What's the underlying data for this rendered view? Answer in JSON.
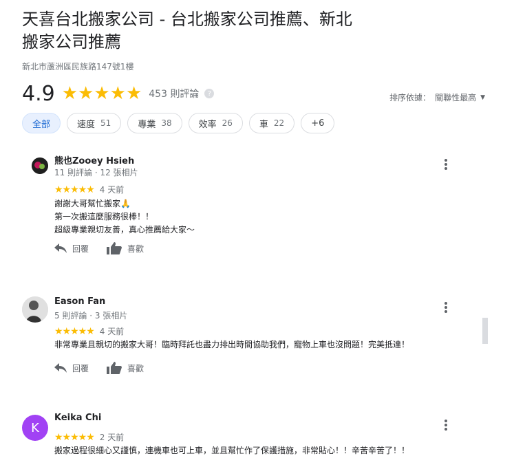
{
  "business": {
    "title": "天喜台北搬家公司 - 台北搬家公司推薦、新北搬家公司推薦",
    "address": "新北市蘆洲區民族路147號1樓",
    "rating": "4.9",
    "stars": "★★★★★",
    "review_count": "453 則評論",
    "help_icon": "?"
  },
  "sort": {
    "label": "排序依據：",
    "value": "關聯性最高",
    "caret": "▼"
  },
  "chips": [
    {
      "label": "全部",
      "num": ""
    },
    {
      "label": "速度",
      "num": "51"
    },
    {
      "label": "專業",
      "num": "38"
    },
    {
      "label": "效率",
      "num": "26"
    },
    {
      "label": "車",
      "num": "22"
    },
    {
      "label": "+6",
      "num": ""
    }
  ],
  "actions": {
    "reply": "回覆",
    "like": "喜歡"
  },
  "reviews": [
    {
      "name": "熊也Zooey Hsieh",
      "meta": "11 則評論 · 12 張相片",
      "stars": "★★★★★",
      "time": "4 天前",
      "text": "謝謝大哥幫忙搬家🙏\n第一次搬這麼服務很棒！！\n超級專業親切友善，真心推薦給大家～"
    },
    {
      "name": "Eason Fan",
      "meta": "5 則評論 · 3 張相片",
      "stars": "★★★★★",
      "time": "4 天前",
      "text": "非常專業且親切的搬家大哥！臨時拜託也盡力排出時間協助我們，寵物上車也沒問題！完美抵達！"
    },
    {
      "name": "Keika Chi",
      "avatar_letter": "K",
      "stars": "★★★★★",
      "time": "2 天前",
      "text": "搬家過程很細心又謹慎，連機車也可上車，並且幫忙作了保護措施，非常貼心！！辛苦辛苦了！！"
    }
  ],
  "colors": {
    "star": "#fbbc04",
    "chip_active_bg": "#e8f0fe",
    "chip_active_text": "#1967d2",
    "avatar_k": "#a142f4"
  }
}
